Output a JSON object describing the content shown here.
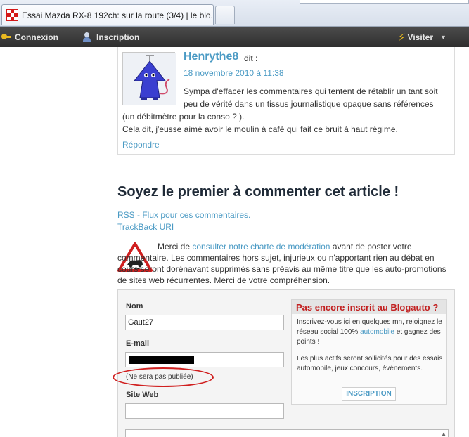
{
  "browser": {
    "tab_title": "Essai Mazda RX-8 192ch: sur la route (3/4) | le blo..."
  },
  "adminbar": {
    "login_label": "Connexion",
    "register_label": "Inscription",
    "visit_label": "Visiter"
  },
  "comment": {
    "author": "Henrythe8",
    "said": "dit :",
    "date": "18 novembre 2010 à 11:38",
    "text_lines": [
      "Sympa d'effacer les commentaires qui tentent de rétablir un tant soit",
      "peu de vérité dans un tissus journalistique opaque sans références",
      "(un débitmètre pour la conso ? ).",
      "Cela dit, j'eusse aimé avoir le moulin à café qui fait ce bruit à haut régime."
    ],
    "reply_label": "Répondre"
  },
  "comments_section": {
    "heading": "Soyez le premier à commenter cet article !",
    "rss_link": "RSS - Flux pour ces commentaires.",
    "trackback_link": "TrackBack URI",
    "charter_prefix": "Merci de ",
    "charter_link": "consulter notre charte de modération",
    "charter_suffix": " avant de poster votre commentaire. Les commentaires hors sujet, injurieux ou n'apportant rien au débat en cours seront dorénavant supprimés sans préavis au même titre que les auto-promotions de sites web récurrentes. Merci de votre compréhension."
  },
  "form": {
    "name_label": "Nom",
    "name_value": "Gaut27",
    "email_label": "E-mail",
    "email_note": "(Ne sera pas publiée)",
    "website_label": "Site Web",
    "website_value": ""
  },
  "promo": {
    "title": "Pas encore inscrit au Blogauto ?",
    "p1_prefix": "Inscrivez-vous ici en quelques mn, rejoignez le réseau social 100% ",
    "p1_link": "automobile",
    "p1_suffix": " et gagnez des points !",
    "p2": "Les plus actifs seront sollicités pour des essais automobile, jeux concours, évènements.",
    "button_label": "INSCRIPTION"
  },
  "colors": {
    "link": "#4a9ac4",
    "promo_title": "#c22020",
    "annotation_ring": "#d01f1f",
    "adminbar": "#3a3a3a"
  }
}
